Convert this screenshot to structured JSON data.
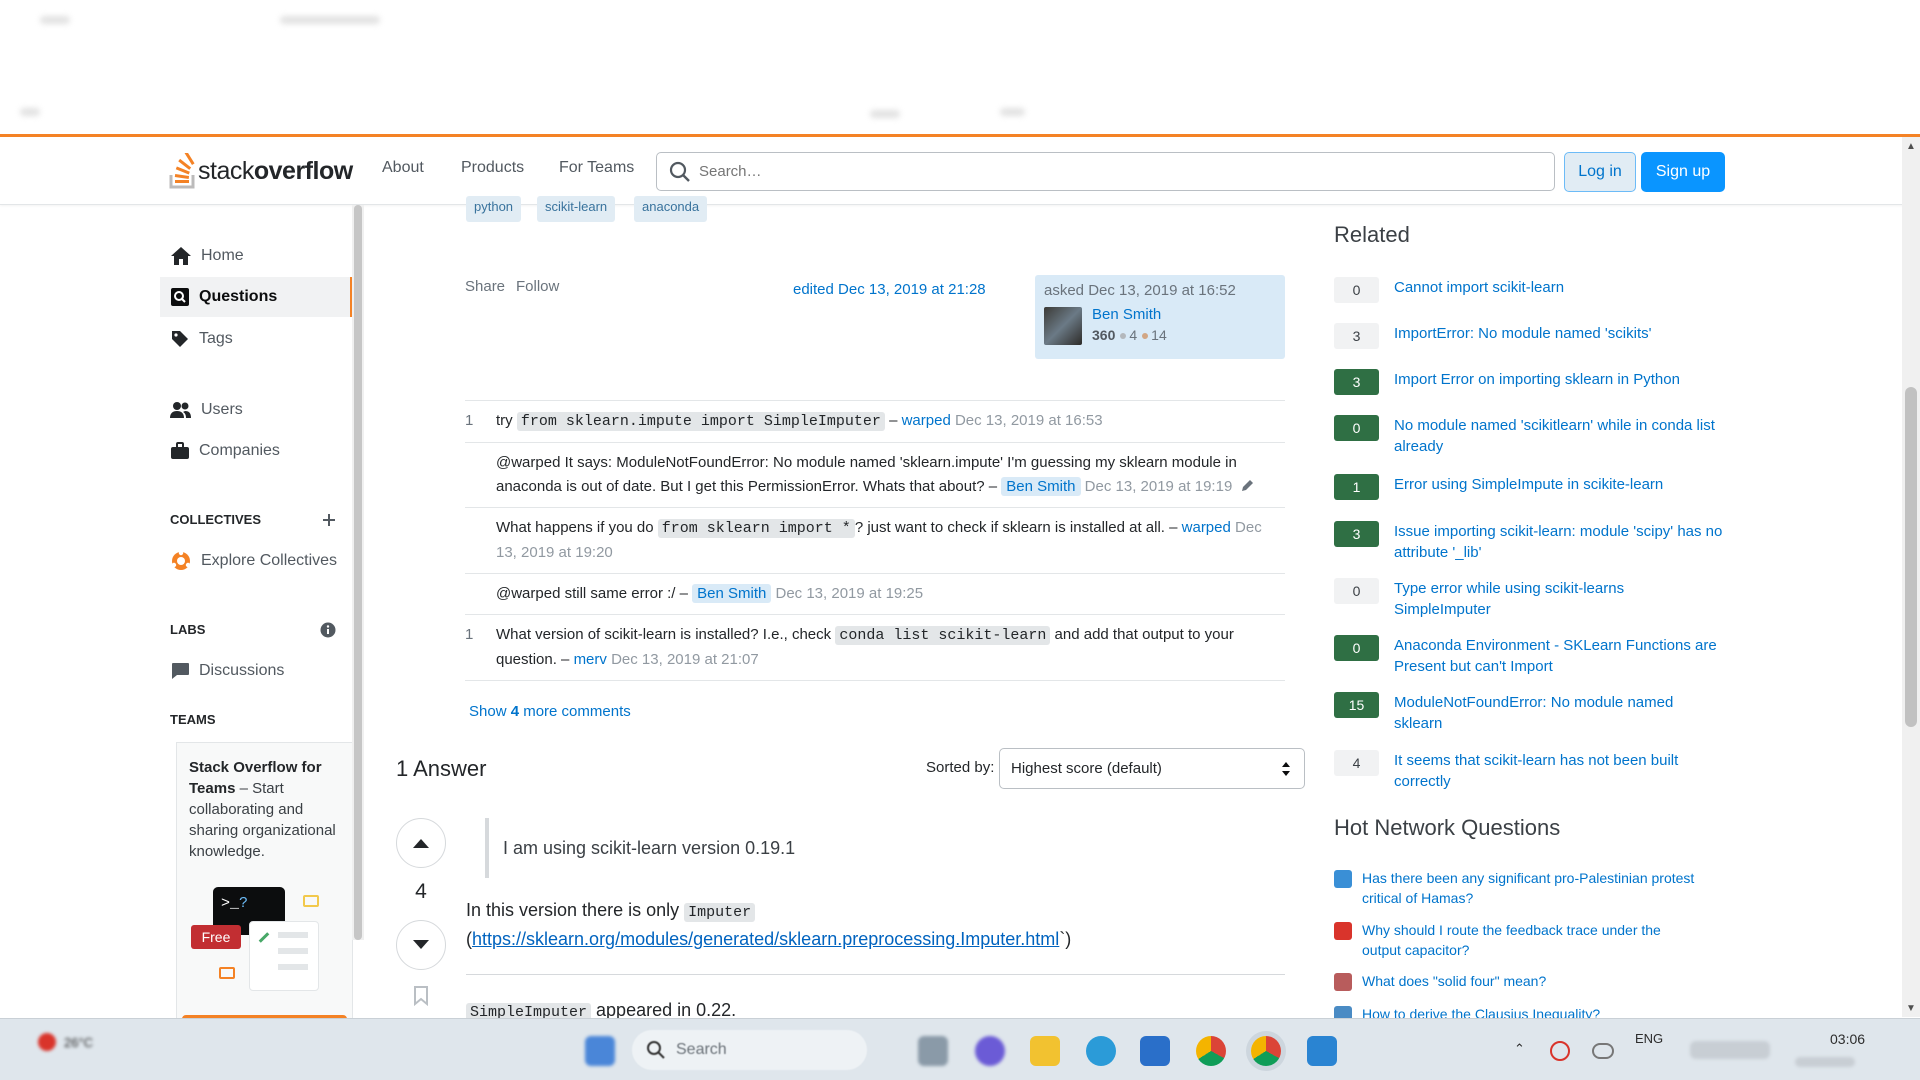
{
  "header": {
    "logo_light": "stack",
    "logo_bold": "overflow",
    "nav": [
      "About",
      "Products",
      "For Teams"
    ],
    "search_placeholder": "Search…",
    "login": "Log in",
    "signup": "Sign up"
  },
  "sidebar": {
    "items": [
      "Home",
      "Questions",
      "Tags",
      "Users",
      "Companies"
    ],
    "collectives_heading": "COLLECTIVES",
    "explore_collectives": "Explore Collectives",
    "labs_heading": "LABS",
    "discussions": "Discussions",
    "teams_heading": "TEAMS",
    "teams_card_bold": "Stack Overflow for Teams",
    "teams_card_text": " – Start collaborating and sharing organizational knowledge.",
    "teams_free": "Free"
  },
  "question": {
    "tags": [
      "python",
      "scikit-learn",
      "anaconda"
    ],
    "share": "Share",
    "follow": "Follow",
    "edited": "edited Dec 13, 2019 at 21:28",
    "asked": "asked Dec 13, 2019 at 16:52",
    "owner_name": "Ben Smith",
    "owner_rep": "360",
    "silver": "4",
    "bronze": "14"
  },
  "comments": [
    {
      "score": "1",
      "pre": "try ",
      "code": "from sklearn.impute import SimpleImputer",
      "post": " – ",
      "user": "warped",
      "date": "Dec 13, 2019 at 16:53"
    },
    {
      "score": "",
      "text": "@warped It says: ModuleNotFoundError: No module named 'sklearn.impute' I'm guessing my sklearn module in anaconda is out of date. But I get this PermissionError. Whats that about? – ",
      "user": "Ben Smith",
      "date": "Dec 13, 2019 at 19:19"
    },
    {
      "score": "",
      "pre": "What happens if you do ",
      "code": "from sklearn import *",
      "post": "? just want to check if sklearn is installed at all. – ",
      "user": "warped",
      "date": "Dec 13, 2019 at 19:20"
    },
    {
      "score": "",
      "text": "@warped still same error :/ – ",
      "user": "Ben Smith",
      "date": "Dec 13, 2019 at 19:25"
    },
    {
      "score": "1",
      "pre": "What version of scikit-learn is installed? I.e., check ",
      "code": "conda list scikit-learn",
      "post": " and add that output to your question. – ",
      "user": "merv",
      "date": "Dec 13, 2019 at 21:07"
    }
  ],
  "show_more": {
    "prefix": "Show ",
    "count": "4",
    "suffix": " more comments"
  },
  "answers": {
    "count_label": "1 Answer",
    "sorted_by": "Sorted by:",
    "sort_value": "Highest score (default)",
    "vote_count": "4",
    "quote": "I am using scikit-learn version 0.19.1",
    "line1_pre": "In this version there is only ",
    "line1_code": "Imputer",
    "link_open": "(",
    "link": "https://sklearn.org/modules/generated/sklearn.preprocessing.Imputer.html",
    "link_close": "`)",
    "line3_code": "SimpleImputer",
    "line3_post": " appeared in 0.22."
  },
  "related": {
    "title": "Related",
    "items": [
      {
        "score": "0",
        "answered": false,
        "title": "Cannot import scikit-learn"
      },
      {
        "score": "3",
        "answered": false,
        "title": "ImportError: No module named 'scikits'"
      },
      {
        "score": "3",
        "answered": true,
        "title": "Import Error on importing sklearn in Python"
      },
      {
        "score": "0",
        "answered": true,
        "title": "No module named 'scikitlearn' while in conda list already"
      },
      {
        "score": "1",
        "answered": true,
        "title": "Error using SimpleImpute in scikite-learn"
      },
      {
        "score": "3",
        "answered": true,
        "title": "Issue importing scikit-learn: module 'scipy' has no attribute '_lib'"
      },
      {
        "score": "0",
        "answered": false,
        "title": "Type error while using scikit-learns SimpleImputer"
      },
      {
        "score": "0",
        "answered": true,
        "title": "Anaconda Environment - SKLearn Functions are Present but can't Import"
      },
      {
        "score": "15",
        "answered": true,
        "title": "ModuleNotFoundError: No module named sklearn"
      },
      {
        "score": "4",
        "answered": false,
        "title": "It seems that scikit-learn has not been built correctly"
      }
    ]
  },
  "hot": {
    "title": "Hot Network Questions",
    "items": [
      {
        "icon_color": "#3a8fd6",
        "title": "Has there been any significant pro-Palestinian protest critical of Hamas?"
      },
      {
        "icon_color": "#d9342b",
        "title": "Why should I route the feedback trace under the output capacitor?"
      },
      {
        "icon_color": "#b85c5c",
        "title": "What does \"solid four\" mean?"
      },
      {
        "icon_color": "#4a8bc4",
        "title": "How to derive the Clausius Inequality?"
      }
    ]
  },
  "taskbar": {
    "search": "Search",
    "weather": "26°C",
    "lang": "ENG",
    "time": "03:06"
  }
}
